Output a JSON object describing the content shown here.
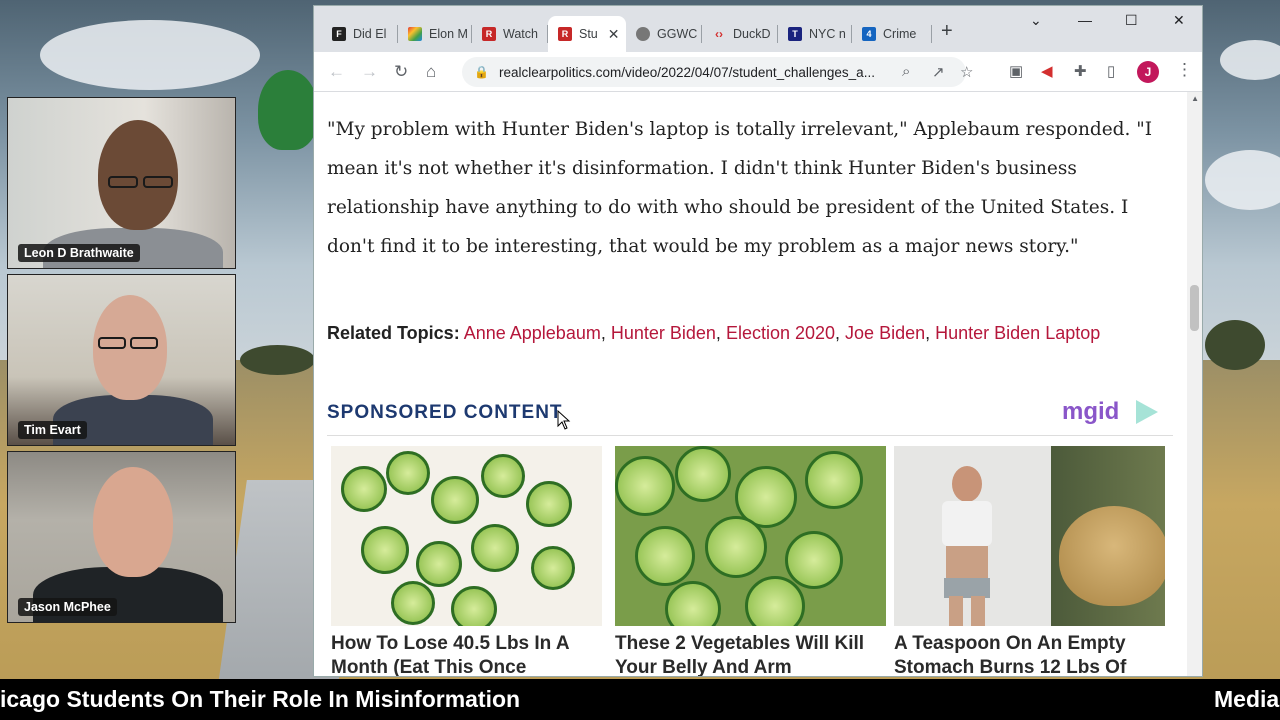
{
  "participants": [
    {
      "name": "Leon D Brathwaite"
    },
    {
      "name": "Tim Evart"
    },
    {
      "name": "Jason McPhee"
    }
  ],
  "browser": {
    "tabs": [
      {
        "label": "Did El",
        "icon": "F"
      },
      {
        "label": "Elon M",
        "icon": "nbc"
      },
      {
        "label": "Watch",
        "icon": "RCP"
      },
      {
        "label": "Stu",
        "icon": "RCP",
        "active": true
      },
      {
        "label": "GGWC",
        "icon": "globe"
      },
      {
        "label": "DuckD",
        "icon": "code"
      },
      {
        "label": "NYC n",
        "icon": "T"
      },
      {
        "label": "Crime",
        "icon": "4"
      }
    ],
    "url": "realclearpolitics.com/video/2022/04/07/student_challenges_a..."
  },
  "article": {
    "paragraph": "\"My problem with Hunter Biden's laptop is totally irrelevant,\" Applebaum responded. \"I mean it's not whether it's disinformation. I didn't think Hunter Biden's business relationship have anything to do with who should be president of the United States. I don't find it to be interesting, that would be my problem as a major news story.\"",
    "related_label": "Related Topics:",
    "related_topics": [
      "Anne Applebaum",
      "Hunter Biden",
      "Election 2020",
      "Joe Biden",
      "Hunter Biden Laptop"
    ]
  },
  "sponsored": {
    "heading": "SPONSORED CONTENT",
    "brand": "mgid",
    "cards": [
      {
        "title": "How To Lose 40.5 Lbs In A Month (Eat This Once"
      },
      {
        "title": "These 2 Vegetables Will Kill Your Belly And Arm"
      },
      {
        "title": "A Teaspoon On An Empty Stomach Burns 12 Lbs Of"
      }
    ]
  },
  "ticker": {
    "text": "icago Students On Their Role In Misinformation",
    "next": "Media"
  }
}
